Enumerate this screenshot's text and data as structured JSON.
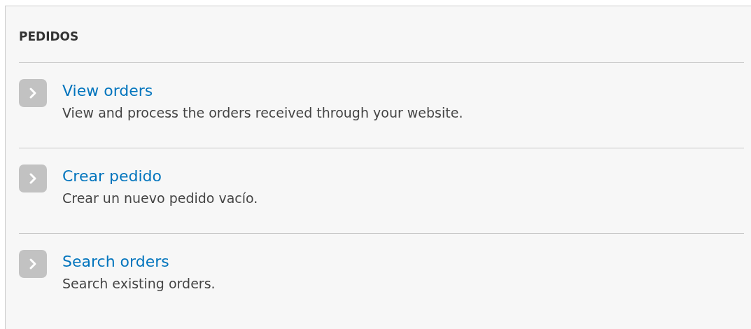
{
  "panel": {
    "title": "PEDIDOS"
  },
  "items": [
    {
      "link": "View orders",
      "description": "View and process the orders received through your website."
    },
    {
      "link": "Crear pedido",
      "description": "Crear un nuevo pedido vacío."
    },
    {
      "link": "Search orders",
      "description": "Search existing orders."
    }
  ]
}
